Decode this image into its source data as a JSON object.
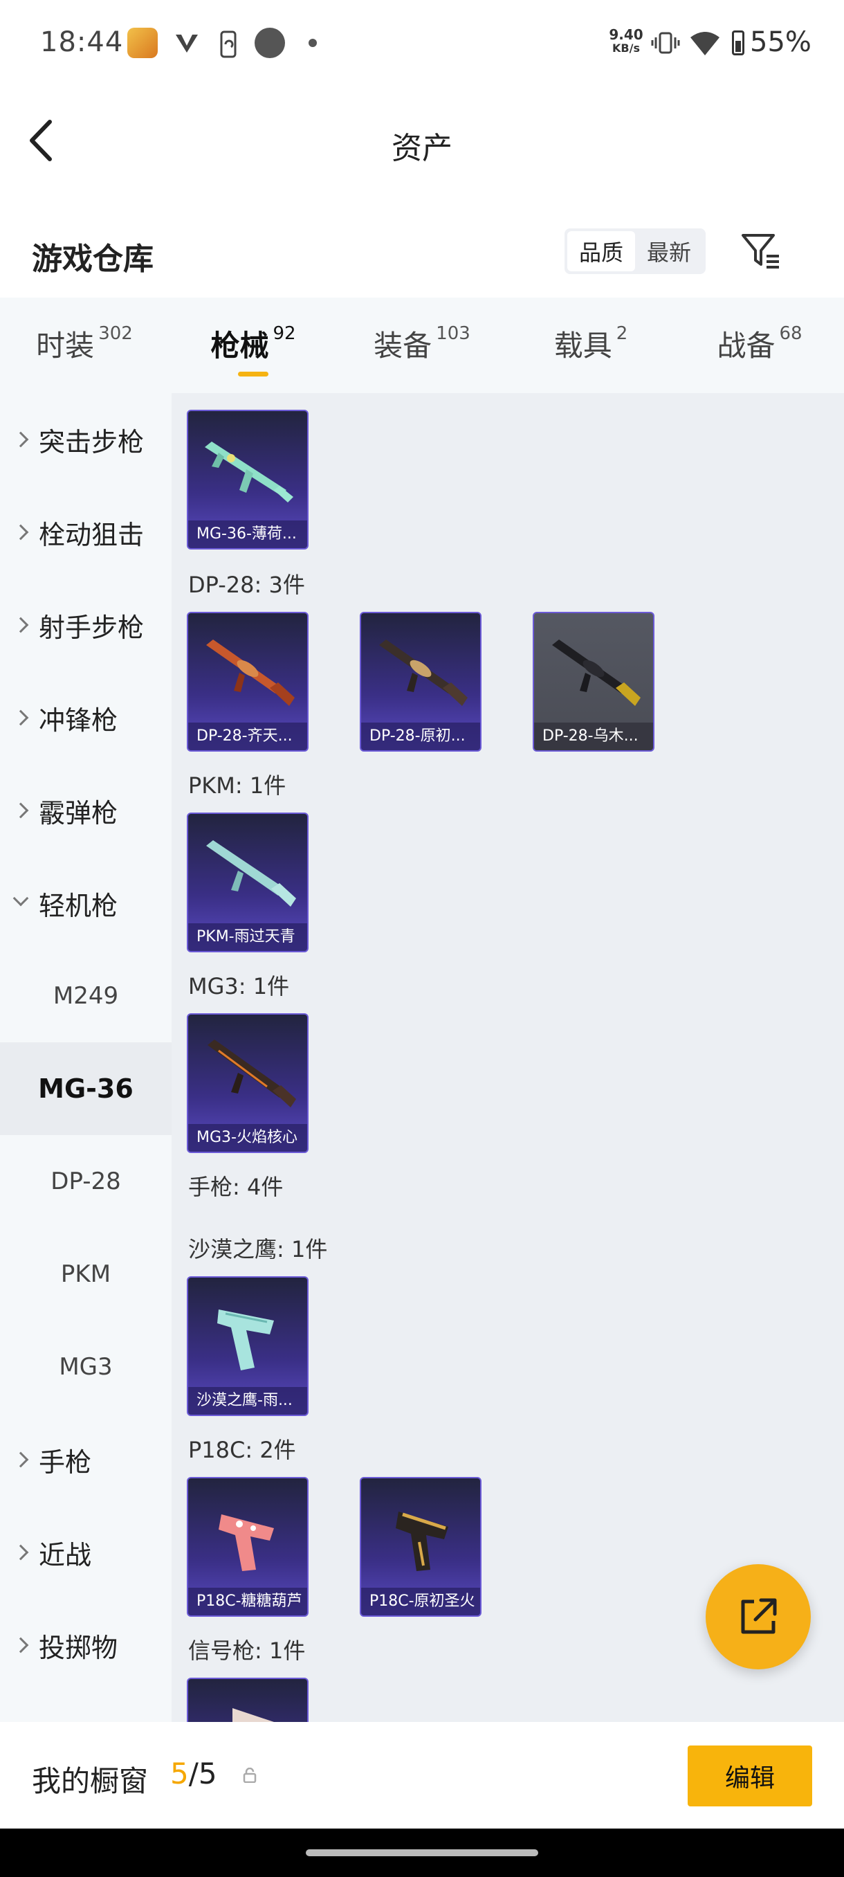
{
  "status_bar": {
    "time": "18:44",
    "speed_value": "9.40",
    "speed_unit": "KB/s",
    "battery": "55%",
    "icons": [
      "app-icon",
      "vpn-icon",
      "screen-rotate-icon",
      "record-icon",
      "dot-icon",
      "vibrate-icon",
      "wifi-icon",
      "battery-icon"
    ]
  },
  "header": {
    "title": "资产",
    "back_icon": "chevron-left-icon"
  },
  "section": {
    "title": "游戏仓库",
    "sort_options": [
      "品质",
      "最新"
    ],
    "sort_active": "品质",
    "filter_icon": "filter-icon"
  },
  "tabs": [
    {
      "label": "时装",
      "count": "302"
    },
    {
      "label": "枪械",
      "count": "92",
      "active": true
    },
    {
      "label": "装备",
      "count": "103"
    },
    {
      "label": "载具",
      "count": "2"
    },
    {
      "label": "战备",
      "count": "68"
    }
  ],
  "sidebar": {
    "categories": [
      {
        "label": "突击步枪"
      },
      {
        "label": "栓动狙击"
      },
      {
        "label": "射手步枪"
      },
      {
        "label": "冲锋枪"
      },
      {
        "label": "霰弹枪"
      },
      {
        "label": "轻机枪",
        "expanded": true
      }
    ],
    "subitems": [
      {
        "label": "M249"
      },
      {
        "label": "MG-36",
        "selected": true
      },
      {
        "label": "DP-28"
      },
      {
        "label": "PKM"
      },
      {
        "label": "MG3"
      }
    ],
    "more_categories": [
      {
        "label": "手枪"
      },
      {
        "label": "近战"
      },
      {
        "label": "投掷物"
      }
    ]
  },
  "content": {
    "groups": {
      "dp28": "DP-28: 3件",
      "pkm": "PKM: 1件",
      "mg3": "MG3: 1件",
      "pistol": "手枪: 4件",
      "deagle": "沙漠之鹰: 1件",
      "p18c": "P18C: 2件",
      "flare": "信号枪: 1件"
    },
    "cards": {
      "mg36_1": "MG-36-薄荷...",
      "dp28_1": "DP-28-齐天...",
      "dp28_2": "DP-28-原初...",
      "dp28_3": "DP-28-乌木...",
      "pkm_1": "PKM-雨过天青",
      "mg3_1": "MG3-火焰核心",
      "deagle_1": "沙漠之鹰-雨...",
      "p18c_1": "P18C-糖糖葫芦",
      "p18c_2": "P18C-原初圣火"
    }
  },
  "fab": {
    "icon": "share-external-icon"
  },
  "bottom_bar": {
    "title": "我的橱窗",
    "current": "5",
    "separator": "/",
    "total": "5",
    "lock_icon": "lock-icon",
    "edit_label": "编辑"
  },
  "colors": {
    "accent": "#f6b018",
    "card_border": "#6b5ad6",
    "card_bg": "#3a2f86"
  }
}
